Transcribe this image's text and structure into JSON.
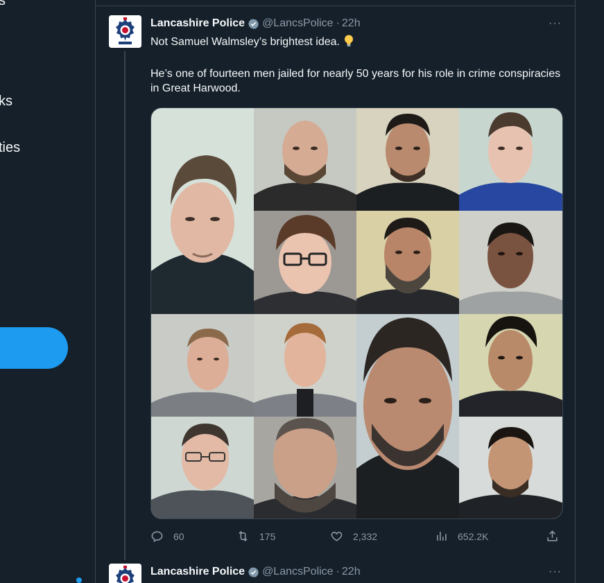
{
  "nav": {
    "fragments": [
      {
        "label": "s"
      },
      {
        "label": "ks"
      },
      {
        "label": "ties"
      }
    ]
  },
  "tweet1": {
    "author_name": "Lancashire Police",
    "handle": "@LancsPolice",
    "separator": "·",
    "time": "22h",
    "more_label": "···",
    "line1": "Not Samuel Walmsley’s brightest idea.",
    "line2": "He’s one of fourteen men jailed for nearly 50 years for his role in crime conspiracies in Great Harwood.",
    "replies": "60",
    "retweets": "175",
    "likes": "2,332",
    "views": "652.2K"
  },
  "tweet2": {
    "author_name": "Lancashire Police",
    "handle": "@LancsPolice",
    "separator": "·",
    "time": "22h",
    "more_label": "···"
  },
  "colors": {
    "background": "#15202b",
    "accent": "#1d9bf0",
    "muted": "#8b98a5",
    "border": "#38444d"
  }
}
